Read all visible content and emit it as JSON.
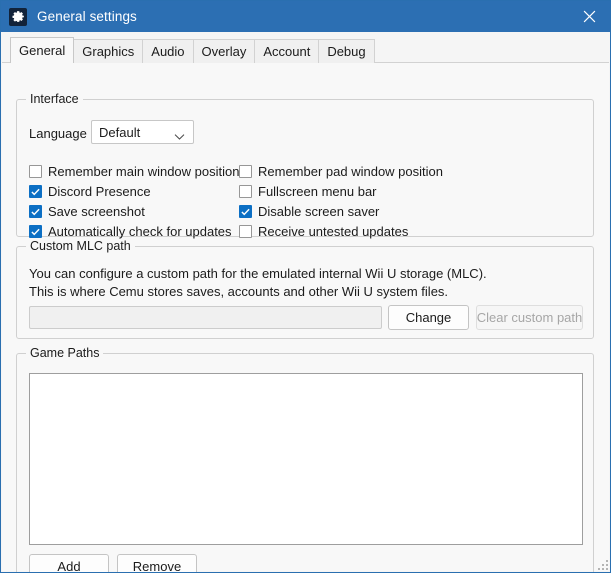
{
  "window": {
    "title": "General settings",
    "icon": "gear-icon",
    "close_label": "✕",
    "titlebar_color": "#2c6fb3",
    "accent_color": "#0c6fc4",
    "border_color": "#2a6fb0"
  },
  "tabs": [
    {
      "label": "General",
      "active": true
    },
    {
      "label": "Graphics",
      "active": false
    },
    {
      "label": "Audio",
      "active": false
    },
    {
      "label": "Overlay",
      "active": false
    },
    {
      "label": "Account",
      "active": false
    },
    {
      "label": "Debug",
      "active": false
    }
  ],
  "interface": {
    "group_label": "Interface",
    "language_label": "Language",
    "language_value": "Default",
    "language_options": [
      "Default"
    ],
    "checkboxes_left": [
      {
        "label": "Remember main window position",
        "checked": false
      },
      {
        "label": "Discord Presence",
        "checked": true
      },
      {
        "label": "Save screenshot",
        "checked": true
      },
      {
        "label": "Automatically check for updates",
        "checked": true
      }
    ],
    "checkboxes_right": [
      {
        "label": "Remember pad window position",
        "checked": false
      },
      {
        "label": "Fullscreen menu bar",
        "checked": false
      },
      {
        "label": "Disable screen saver",
        "checked": true
      },
      {
        "label": "Receive untested updates",
        "checked": false
      }
    ]
  },
  "mlc": {
    "group_label": "Custom MLC path",
    "description_lines": [
      "You can configure a custom path for the emulated internal Wii U storage (MLC).",
      "This is where Cemu stores saves, accounts and other Wii U system files."
    ],
    "path_value": "",
    "path_placeholder": "",
    "change_button": "Change",
    "clear_button": "Clear custom path",
    "clear_button_disabled": true
  },
  "game_paths": {
    "group_label": "Game Paths",
    "items": [],
    "add_button": "Add",
    "remove_button": "Remove"
  }
}
